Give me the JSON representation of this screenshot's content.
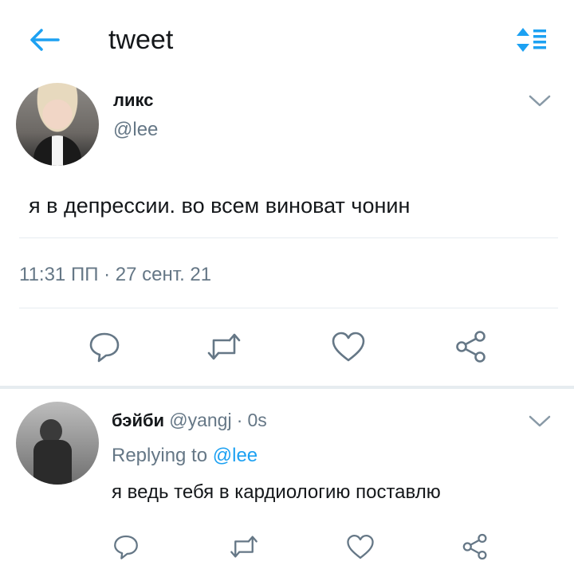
{
  "header": {
    "title": "tweet",
    "back_icon": "arrow-left-icon",
    "sort_icon": "sort-icon",
    "accent": "#1da1f2"
  },
  "tweet": {
    "author_name": "ликс",
    "author_handle": "@lee",
    "text": "я в депрессии. во всем виноват чонин",
    "time": "11:31 ПП",
    "separator": "·",
    "date": "27 сент. 21",
    "actions": [
      "reply-icon",
      "retweet-icon",
      "like-icon",
      "share-icon"
    ]
  },
  "reply": {
    "author_name": "бэйби",
    "author_handle": "@yangj",
    "separator": "·",
    "age": "0s",
    "replying_prefix": "Replying to",
    "replying_mention": "@lee",
    "text": "я ведь тебя в кардиологию поставлю",
    "actions": [
      "reply-icon",
      "retweet-icon",
      "like-icon",
      "share-icon"
    ]
  },
  "colors": {
    "text": "#14171a",
    "secondary": "#657786",
    "divider": "#e6ecf0",
    "link": "#1da1f2"
  }
}
